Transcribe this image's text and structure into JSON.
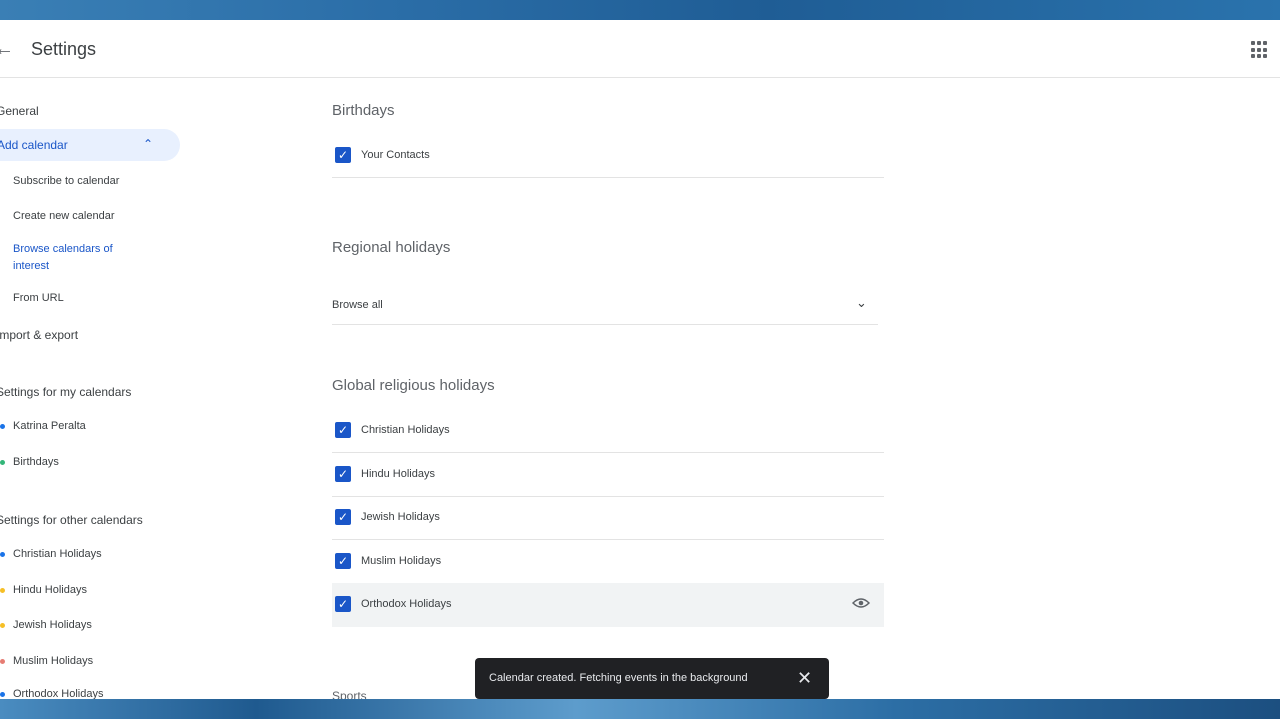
{
  "header": {
    "back_icon": "back-arrow-icon",
    "title": "Settings",
    "apps_icon": "apps-grid-icon"
  },
  "sidebar": {
    "general": "General",
    "add_calendar": "Add calendar",
    "sub_items": {
      "subscribe": "Subscribe to calendar",
      "create": "Create new calendar",
      "browse": "Browse calendars of interest",
      "from_url": "From URL"
    },
    "import_export": "Import & export",
    "my_calendars_heading": "Settings for my calendars",
    "my_calendars": [
      {
        "label": "Katrina Peralta",
        "color": "#1a73e8"
      },
      {
        "label": "Birthdays",
        "color": "#33b679"
      }
    ],
    "other_calendars_heading": "Settings for other calendars",
    "other_calendars": [
      {
        "label": "Christian Holidays",
        "color": "#1a73e8"
      },
      {
        "label": "Hindu Holidays",
        "color": "#f6bf26"
      },
      {
        "label": "Jewish Holidays",
        "color": "#f6bf26"
      },
      {
        "label": "Muslim Holidays",
        "color": "#e67c73"
      },
      {
        "label": "Orthodox Holidays",
        "color": "#1a73e8"
      }
    ]
  },
  "main": {
    "birthdays": {
      "title": "Birthdays",
      "items": [
        {
          "label": "Your Contacts",
          "checked": true
        }
      ]
    },
    "regional": {
      "title": "Regional holidays",
      "select_value": "Browse all"
    },
    "religious": {
      "title": "Global religious holidays",
      "items": [
        {
          "label": "Christian Holidays",
          "checked": true
        },
        {
          "label": "Hindu Holidays",
          "checked": true
        },
        {
          "label": "Jewish Holidays",
          "checked": true
        },
        {
          "label": "Muslim Holidays",
          "checked": true
        },
        {
          "label": "Orthodox Holidays",
          "checked": true
        }
      ]
    },
    "next_heading": "Sports"
  },
  "snackbar": {
    "message": "Calendar created. Fetching events in the background",
    "close_icon": "close-icon"
  }
}
